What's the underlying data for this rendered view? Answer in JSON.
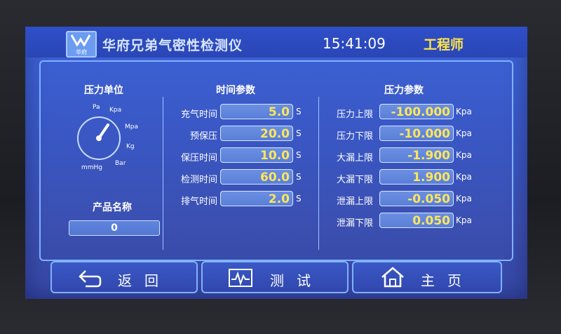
{
  "header": {
    "logo_text": "华府",
    "app_title": "华府兄弟气密性检测仪",
    "time": "15:41:09",
    "user_role": "工程师"
  },
  "pressure_unit": {
    "title": "压力单位",
    "options": [
      "Pa",
      "Kpa",
      "Mpa",
      "Kg",
      "Bar",
      "mmHg"
    ]
  },
  "product": {
    "title": "产品名称",
    "value": "0"
  },
  "time_params": {
    "title": "时间参数",
    "unit": "S",
    "rows": [
      {
        "label": "充气时间",
        "value": "5.0"
      },
      {
        "label": "预保压",
        "value": "20.0"
      },
      {
        "label": "保压时间",
        "value": "10.0"
      },
      {
        "label": "检测时间",
        "value": "60.0"
      },
      {
        "label": "排气时间",
        "value": "2.0"
      }
    ]
  },
  "pressure_params": {
    "title": "压力参数",
    "unit": "Kpa",
    "rows": [
      {
        "label": "压力上限",
        "value": "-100.000"
      },
      {
        "label": "压力下限",
        "value": "-10.000"
      },
      {
        "label": "大漏上限",
        "value": "-1.900"
      },
      {
        "label": "大漏下限",
        "value": "1.900"
      },
      {
        "label": "泄漏上限",
        "value": "-0.050"
      },
      {
        "label": "泄漏下限",
        "value": "0.050"
      }
    ]
  },
  "buttons": {
    "back": "返回",
    "test": "测试",
    "home": "主页"
  },
  "colors": {
    "screen": "#3a57c4",
    "value_text": "#ffe55a",
    "role_text": "#ffe64a",
    "border": "#7fb2ff"
  }
}
